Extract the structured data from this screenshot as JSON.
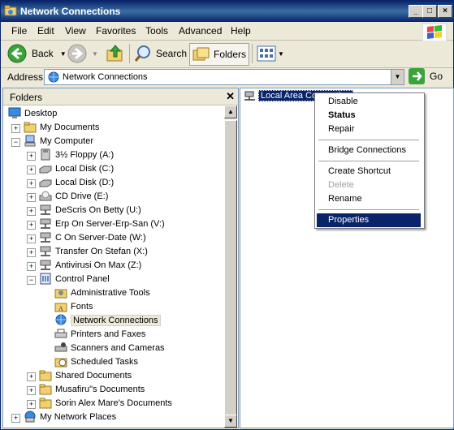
{
  "window": {
    "title": "Network Connections"
  },
  "menubar": [
    "File",
    "Edit",
    "View",
    "Favorites",
    "Tools",
    "Advanced",
    "Help"
  ],
  "toolbar": {
    "back": "Back",
    "search": "Search",
    "folders": "Folders"
  },
  "address": {
    "label": "Address",
    "value": "Network Connections",
    "go": "Go"
  },
  "folders_pane": {
    "title": "Folders",
    "tree": [
      {
        "label": "Desktop",
        "icon": "desktop-icon"
      },
      {
        "label": "My Documents",
        "icon": "folder-icon"
      },
      {
        "label": "My Computer",
        "icon": "computer-icon"
      },
      {
        "label": "3½ Floppy (A:)",
        "icon": "floppy-icon"
      },
      {
        "label": "Local Disk (C:)",
        "icon": "disk-icon"
      },
      {
        "label": "Local Disk (D:)",
        "icon": "disk-icon"
      },
      {
        "label": "CD Drive (E:)",
        "icon": "cd-icon"
      },
      {
        "label": "DeScris On Betty (U:)",
        "icon": "network-drive-icon"
      },
      {
        "label": "Erp On Server-Erp-San (V:)",
        "icon": "network-drive-icon"
      },
      {
        "label": "C On Server-Date (W:)",
        "icon": "network-drive-icon"
      },
      {
        "label": "Transfer On Stefan (X:)",
        "icon": "network-drive-icon"
      },
      {
        "label": "Antivirusi On Max (Z:)",
        "icon": "network-drive-icon"
      },
      {
        "label": "Control Panel",
        "icon": "control-panel-icon"
      },
      {
        "label": "Administrative Tools",
        "icon": "admin-tools-icon"
      },
      {
        "label": "Fonts",
        "icon": "fonts-folder-icon"
      },
      {
        "label": "Network Connections",
        "icon": "network-connections-icon"
      },
      {
        "label": "Printers and Faxes",
        "icon": "printer-icon"
      },
      {
        "label": "Scanners and Cameras",
        "icon": "scanner-icon"
      },
      {
        "label": "Scheduled Tasks",
        "icon": "scheduled-tasks-icon"
      },
      {
        "label": "Shared Documents",
        "icon": "folder-icon"
      },
      {
        "label": "Musafiru\"s Documents",
        "icon": "folder-icon"
      },
      {
        "label": "Sorin Alex Mare's Documents",
        "icon": "folder-icon"
      },
      {
        "label": "My Network Places",
        "icon": "network-places-icon"
      }
    ]
  },
  "content": {
    "item_label": "Local Area Connection"
  },
  "context_menu": [
    {
      "label": "Disable"
    },
    {
      "label": "Status"
    },
    {
      "label": "Repair"
    },
    {
      "label": "Bridge Connections"
    },
    {
      "label": "Create Shortcut"
    },
    {
      "label": "Delete"
    },
    {
      "label": "Rename"
    },
    {
      "label": "Properties"
    }
  ],
  "colors": {
    "title_bar": "#0a246a",
    "selection": "#0a246a",
    "window_bg": "#ece9d8"
  }
}
